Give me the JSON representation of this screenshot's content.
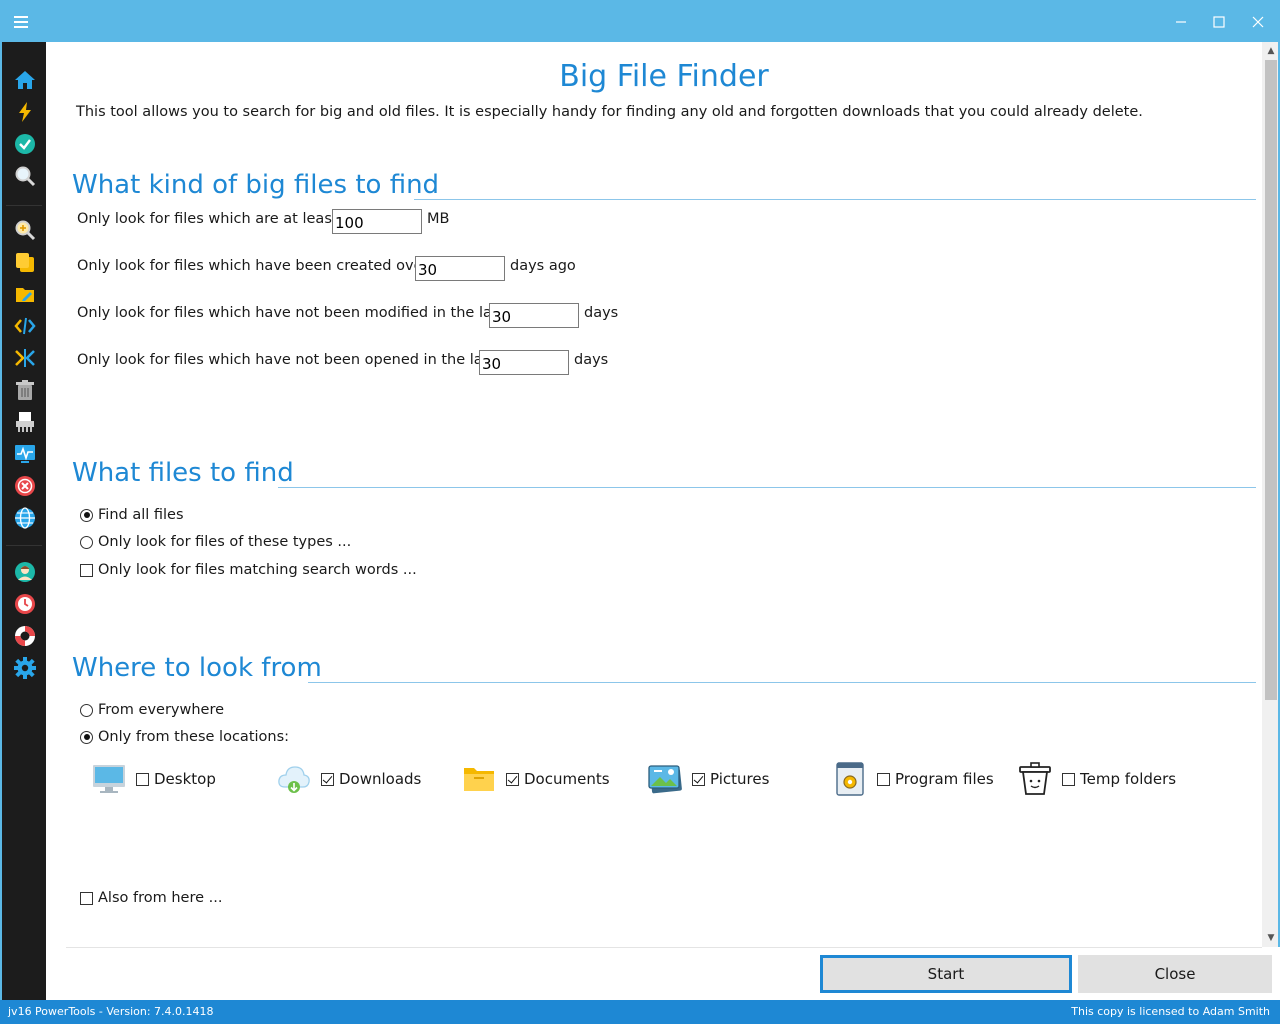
{
  "window": {
    "menu_icon": "hamburger-menu-icon",
    "controls": [
      "minimize-icon",
      "maximize-icon",
      "close-icon"
    ]
  },
  "sidebar": {
    "icons": [
      "home-icon",
      "lightning-icon",
      "check-circle-icon",
      "search-icon",
      "magnifier-plus-icon",
      "copy-icon",
      "folder-edit-icon",
      "code-arrows-icon",
      "merge-arrows-icon",
      "trash-icon",
      "shredder-icon",
      "monitor-graph-icon",
      "error-circle-icon",
      "globe-icon",
      "user-avatar-icon",
      "clock-icon",
      "lifebuoy-icon",
      "gear-icon"
    ]
  },
  "page": {
    "title": "Big File Finder",
    "intro": "This tool allows you to search for big and old files. It is especially handy for finding any old and forgotten downloads that you could already delete."
  },
  "kind": {
    "heading": "What kind of big files to find",
    "size_label": "Only look for files which are at least:",
    "size_value": "100",
    "size_unit": "MB",
    "created_label": "Only look for files which have been created over",
    "created_value": "30",
    "created_unit": "days ago",
    "modified_label": "Only look for files which have not been modified in the last",
    "modified_value": "30",
    "modified_unit": "days",
    "opened_label": "Only look for files which have not been opened in the last",
    "opened_value": "30",
    "opened_unit": "days"
  },
  "what": {
    "heading": "What files to find",
    "options": [
      {
        "label": "Find all files",
        "type": "radio",
        "checked": true
      },
      {
        "label": "Only look for files of these types ...",
        "type": "radio",
        "checked": false
      },
      {
        "label": "Only look for files matching search words ...",
        "type": "checkbox",
        "checked": false
      }
    ]
  },
  "where": {
    "heading": "Where to look from",
    "options": [
      {
        "label": "From everywhere",
        "checked": false
      },
      {
        "label": "Only from these locations:",
        "checked": true
      }
    ],
    "locations": [
      {
        "label": "Desktop",
        "icon": "monitor-icon",
        "checked": false
      },
      {
        "label": "Downloads",
        "icon": "cloud-download-icon",
        "checked": true
      },
      {
        "label": "Documents",
        "icon": "folder-icon",
        "checked": true
      },
      {
        "label": "Pictures",
        "icon": "pictures-icon",
        "checked": true
      },
      {
        "label": "Program files",
        "icon": "program-files-icon",
        "checked": false
      },
      {
        "label": "Temp folders",
        "icon": "recycle-bin-icon",
        "checked": false
      }
    ],
    "also_label": "Also from here ...",
    "also_checked": false
  },
  "buttons": {
    "start": "Start",
    "close": "Close"
  },
  "status": {
    "left": "jv16 PowerTools - Version: 7.4.0.1418",
    "right": "This copy is licensed to Adam Smith"
  },
  "colors": {
    "accent": "#1e88d4",
    "titlebar": "#5bb8e6",
    "sidebar": "#1c1c1c"
  }
}
